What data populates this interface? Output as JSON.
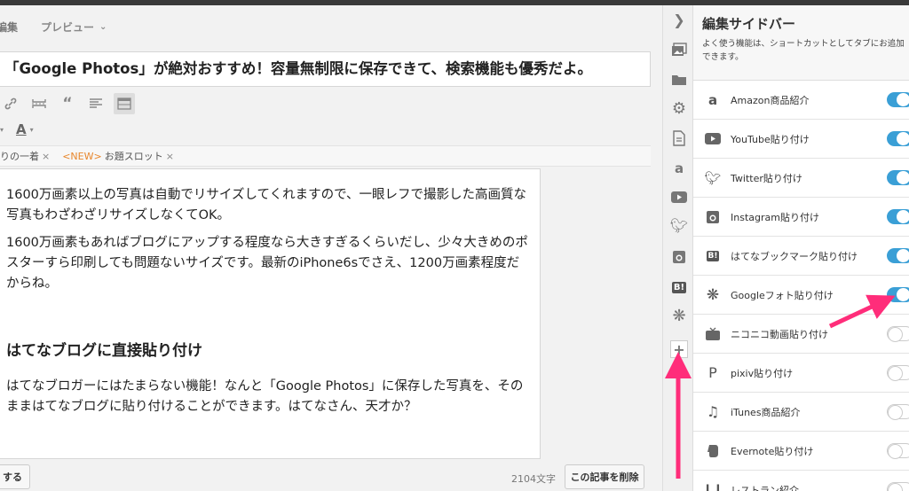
{
  "editor": {
    "tabs": {
      "edit": "編集",
      "preview": "プレビュー"
    },
    "title": "「Google Photos」が絶対おすすめ！容量無制限に保存できて、検索機能も優秀だよ。",
    "keywords": [
      {
        "label": "りの一着"
      },
      {
        "prefix": "<NEW>",
        "label": "お題スロット"
      }
    ],
    "body": {
      "cut_line": "———————————————————————————",
      "para1": "1600万画素以上の写真は自動でリサイズしてくれますので、一眼レフで撮影した高画質な写真もわざわざリサイズしなくてOK。",
      "para2": "1600万画素もあればブログにアップする程度なら大きすぎるくらいだし、少々大きめのポスターすら印刷しても問題ないサイズです。最新のiPhone6sでさえ、1200万画素程度だからね。",
      "heading": "はてなブログに直接貼り付け",
      "para3": "はてなブロガーにはたまらない機能！なんと「Google Photos」に保存した写真を、そのままはてなブログに貼り付けることができます。はてなさん、天才か？"
    },
    "footer": {
      "save_label": "する",
      "char_count": "2104文字",
      "delete_label": "この記事を削除"
    }
  },
  "sidebar": {
    "title": "編集サイドバー",
    "description": "よく使う機能は、ショートカットとしてタブにお追加できます。",
    "items": [
      {
        "icon": "amazon-icon",
        "label": "Amazon商品紹介",
        "enabled": true
      },
      {
        "icon": "youtube-icon",
        "label": "YouTube貼り付け",
        "enabled": true
      },
      {
        "icon": "twitter-icon",
        "label": "Twitter貼り付け",
        "enabled": true
      },
      {
        "icon": "instagram-icon",
        "label": "Instagram貼り付け",
        "enabled": true
      },
      {
        "icon": "hatena-bookmark-icon",
        "label": "はてなブックマーク貼り付け",
        "enabled": true
      },
      {
        "icon": "google-photos-icon",
        "label": "Googleフォト貼り付け",
        "enabled": true
      },
      {
        "icon": "niconico-icon",
        "label": "ニコニコ動画貼り付け",
        "enabled": false
      },
      {
        "icon": "pixiv-icon",
        "label": "pixiv貼り付け",
        "enabled": false
      },
      {
        "icon": "music-note-icon",
        "label": "iTunes商品紹介",
        "enabled": false
      },
      {
        "icon": "evernote-icon",
        "label": "Evernote貼り付け",
        "enabled": false
      },
      {
        "icon": "restaurant-icon",
        "label": "レストラン紹介",
        "enabled": false
      }
    ]
  },
  "annotations": {
    "arrow_color": "#ff2d7a"
  }
}
